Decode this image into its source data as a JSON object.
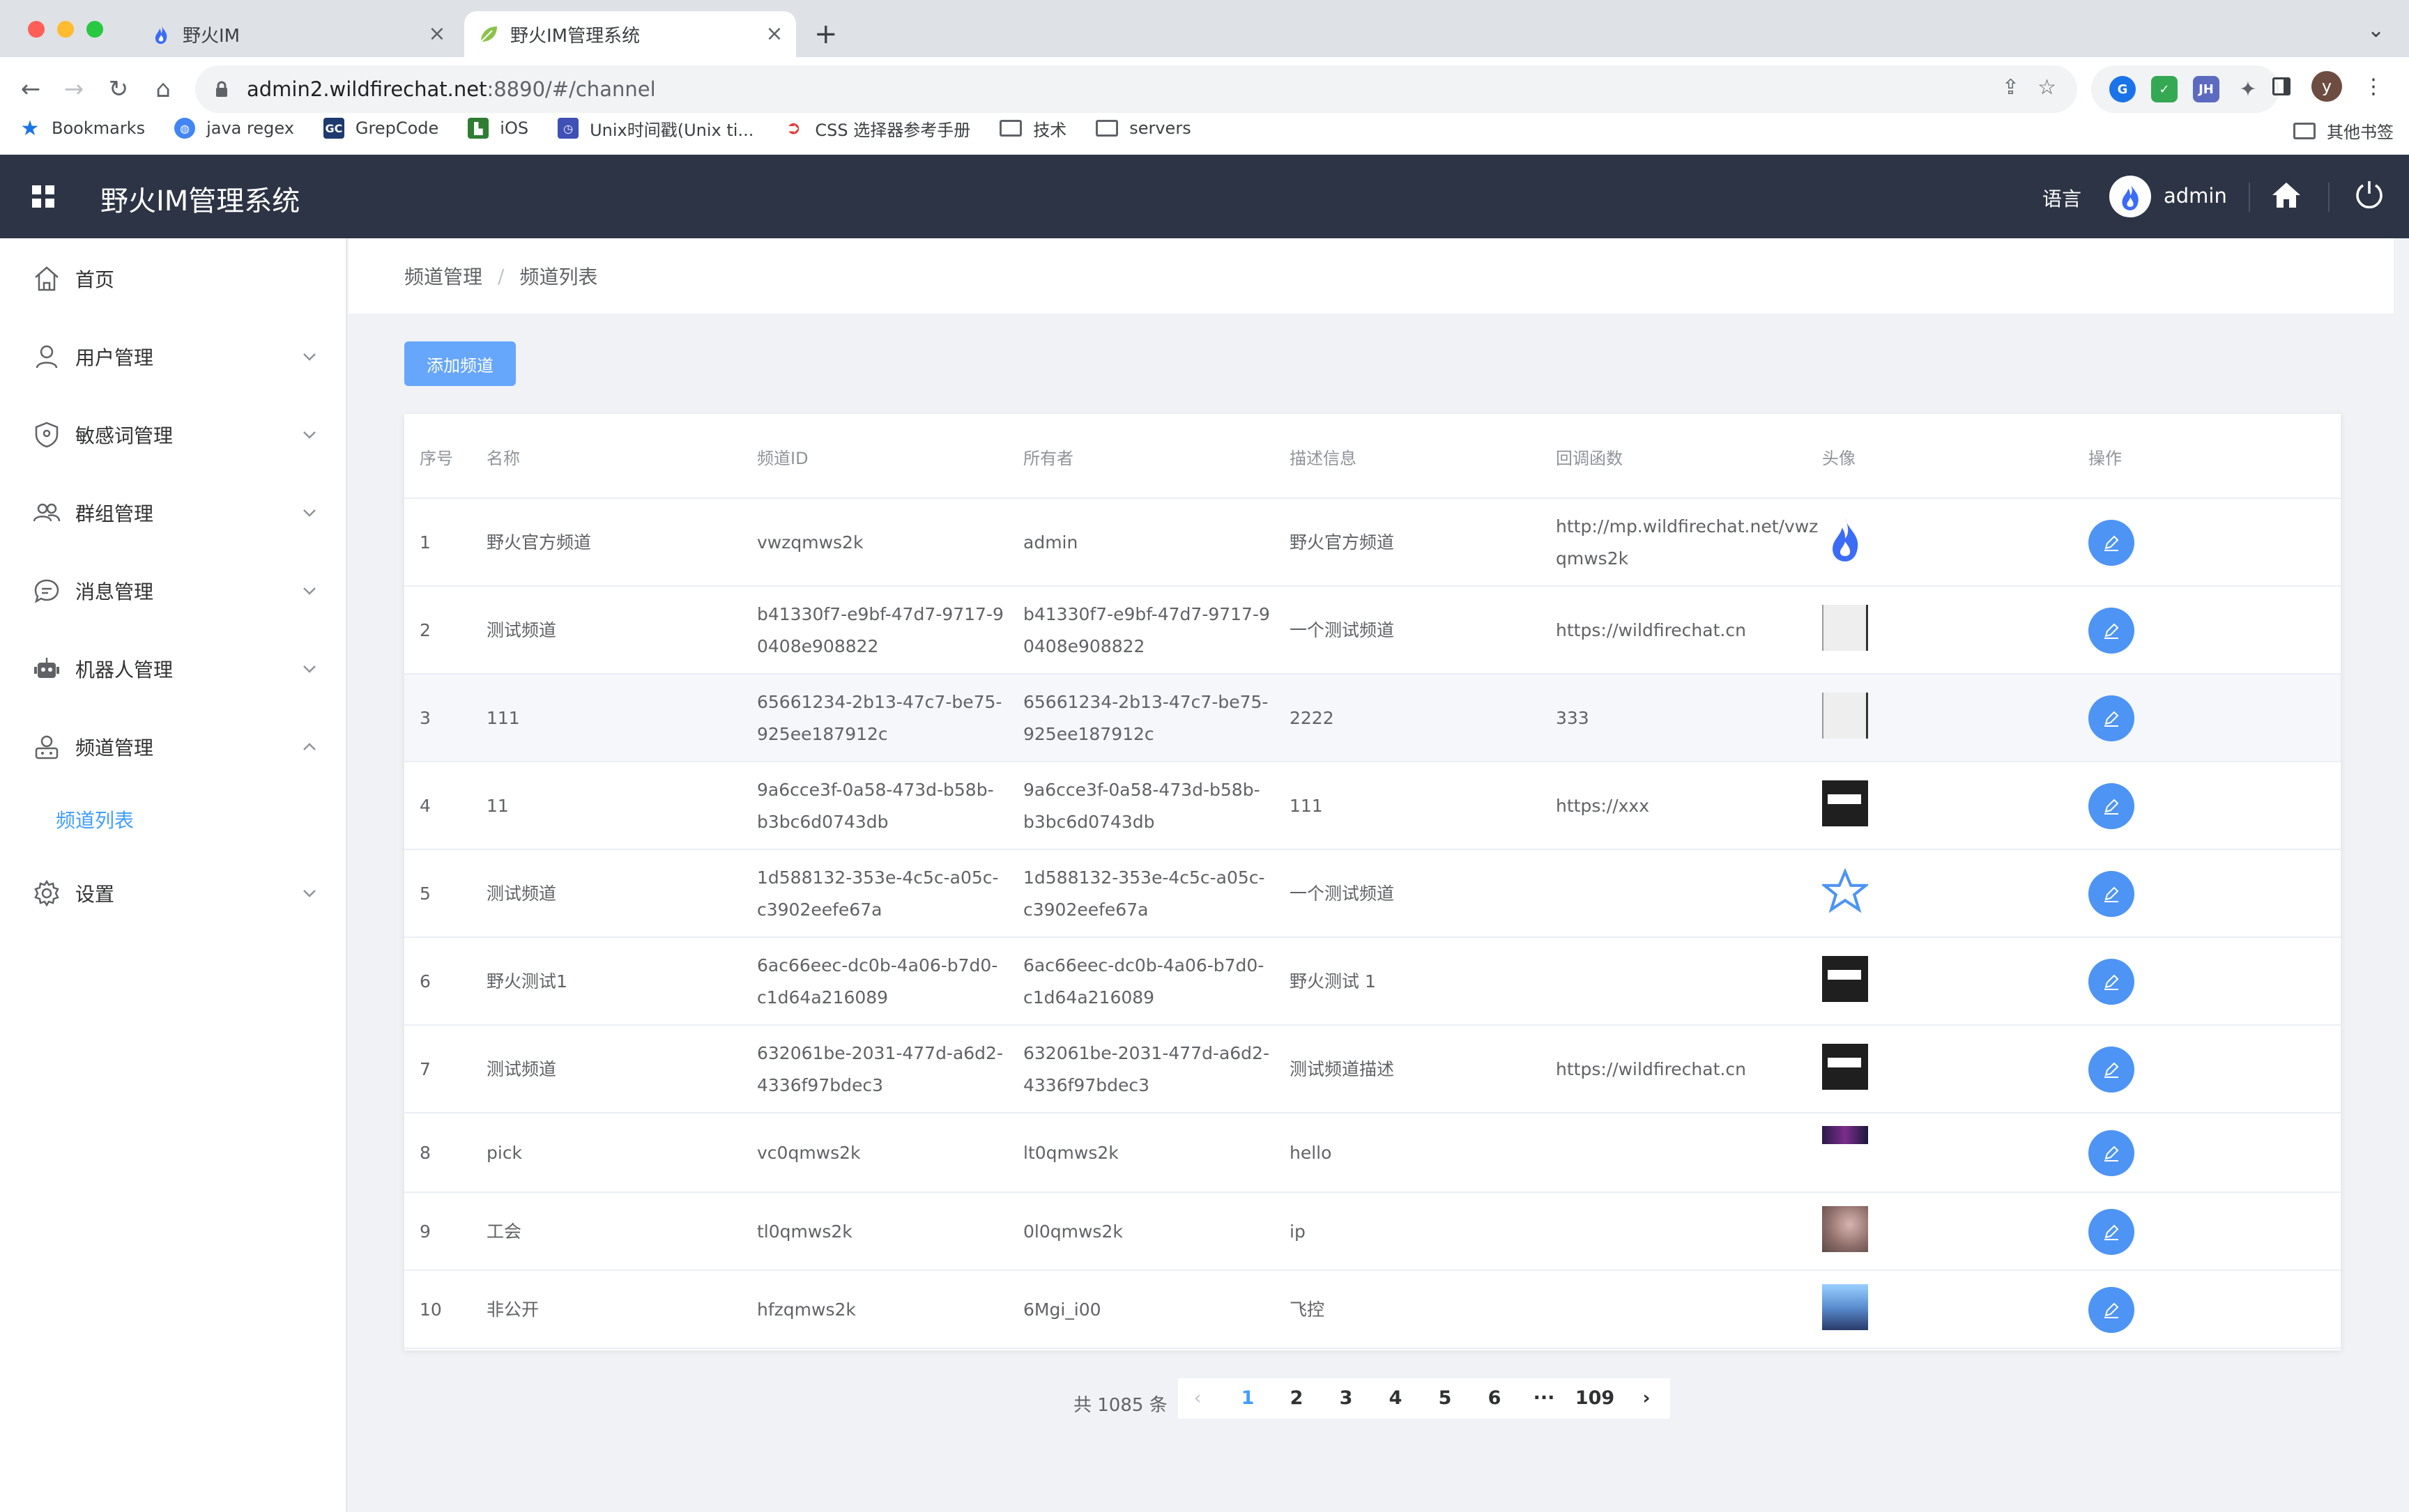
{
  "browser": {
    "tabs": [
      {
        "title": "野火IM",
        "active": false
      },
      {
        "title": "野火IM管理系统",
        "active": true
      }
    ],
    "url_host": "admin2.wildfirechat.net",
    "url_rest": ":8890/#/channel",
    "bookmarks": [
      {
        "label": "Bookmarks",
        "icon": "star-icon"
      },
      {
        "label": "java regex",
        "icon": "globe-icon"
      },
      {
        "label": "GrepCode",
        "icon": "gc-icon"
      },
      {
        "label": "iOS",
        "icon": "ios-icon"
      },
      {
        "label": "Unix时间戳(Unix ti...",
        "icon": "clock-icon"
      },
      {
        "label": "CSS 选择器参考手册",
        "icon": "css-icon"
      },
      {
        "label": "技术",
        "icon": "folder-icon"
      },
      {
        "label": "servers",
        "icon": "folder-icon"
      }
    ],
    "other_bookmarks": "其他书签",
    "ext_jh": "JH",
    "profile_initial": "y"
  },
  "header": {
    "title": "野火IM管理系统",
    "language": "语言",
    "user": "admin"
  },
  "sidebar": {
    "items": [
      {
        "label": "首页",
        "icon": "home-icon"
      },
      {
        "label": "用户管理",
        "icon": "user-icon"
      },
      {
        "label": "敏感词管理",
        "icon": "shield-icon"
      },
      {
        "label": "群组管理",
        "icon": "group-icon"
      },
      {
        "label": "消息管理",
        "icon": "message-icon"
      },
      {
        "label": "机器人管理",
        "icon": "robot-icon"
      },
      {
        "label": "频道管理",
        "icon": "channel-icon"
      },
      {
        "label": "设置",
        "icon": "gear-icon"
      }
    ],
    "sub_item": "频道列表"
  },
  "breadcrumb": {
    "parent": "频道管理",
    "current": "频道列表"
  },
  "add_button": "添加频道",
  "table": {
    "headers": [
      "序号",
      "名称",
      "频道ID",
      "所有者",
      "描述信息",
      "回调函数",
      "头像",
      "操作"
    ],
    "rows": [
      {
        "index": "1",
        "name": "野火官方频道",
        "id1": "vwzqmws2k",
        "id2": "",
        "owner1": "admin",
        "owner2": "",
        "desc": "野火官方频道",
        "cb1": "http://mp.wildfirechat.net/vwz",
        "cb2": "qmws2k",
        "avatar": "flame"
      },
      {
        "index": "2",
        "name": "测试频道",
        "id1": "b41330f7-e9bf-47d7-9717-9",
        "id2": "0408e908822",
        "owner1": "b41330f7-e9bf-47d7-9717-9",
        "owner2": "0408e908822",
        "desc": "一个测试频道",
        "cb1": "https://wildfirechat.cn",
        "cb2": "",
        "avatar": "blank"
      },
      {
        "index": "3",
        "name": "111",
        "id1": "65661234-2b13-47c7-be75-",
        "id2": "925ee187912c",
        "owner1": "65661234-2b13-47c7-be75-",
        "owner2": "925ee187912c",
        "desc": "2222",
        "cb1": "333",
        "cb2": "",
        "avatar": "blank"
      },
      {
        "index": "4",
        "name": "11",
        "id1": "9a6cce3f-0a58-473d-b58b-",
        "id2": "b3bc6d0743db",
        "owner1": "9a6cce3f-0a58-473d-b58b-",
        "owner2": "b3bc6d0743db",
        "desc": "111",
        "cb1": "https://xxx",
        "cb2": "",
        "avatar": "dark"
      },
      {
        "index": "5",
        "name": "测试频道",
        "id1": "1d588132-353e-4c5c-a05c-",
        "id2": "c3902eefe67a",
        "owner1": "1d588132-353e-4c5c-a05c-",
        "owner2": "c3902eefe67a",
        "desc": "一个测试频道",
        "cb1": "",
        "cb2": "",
        "avatar": "star"
      },
      {
        "index": "6",
        "name": "野火测试1",
        "id1": "6ac66eec-dc0b-4a06-b7d0-",
        "id2": "c1d64a216089",
        "owner1": "6ac66eec-dc0b-4a06-b7d0-",
        "owner2": "c1d64a216089",
        "desc": "野火测试 1",
        "cb1": "",
        "cb2": "",
        "avatar": "dark"
      },
      {
        "index": "7",
        "name": "测试频道",
        "id1": "632061be-2031-477d-a6d2-",
        "id2": "4336f97bdec3",
        "owner1": "632061be-2031-477d-a6d2-",
        "owner2": "4336f97bdec3",
        "desc": "测试频道描述",
        "cb1": "https://wildfirechat.cn",
        "cb2": "",
        "avatar": "dark"
      },
      {
        "index": "8",
        "name": "pick",
        "id1": "vc0qmws2k",
        "id2": "",
        "owner1": "lt0qmws2k",
        "owner2": "",
        "desc": "hello",
        "cb1": "",
        "cb2": "",
        "avatar": "banner"
      },
      {
        "index": "9",
        "name": "工会",
        "id1": "tl0qmws2k",
        "id2": "",
        "owner1": "0l0qmws2k",
        "owner2": "",
        "desc": "ip",
        "cb1": "",
        "cb2": "",
        "avatar": "photo"
      },
      {
        "index": "10",
        "name": "非公开",
        "id1": "hfzqmws2k",
        "id2": "",
        "owner1": "6Mgi_i00",
        "owner2": "",
        "desc": "飞控",
        "cb1": "",
        "cb2": "",
        "avatar": "anime"
      }
    ]
  },
  "pagination": {
    "total_text": "共 1085 条",
    "pages": [
      "1",
      "2",
      "3",
      "4",
      "5",
      "6"
    ],
    "ellipsis": "···",
    "last": "109",
    "current": "1"
  },
  "colors": {
    "header_bg": "#2d3445",
    "accent": "#409eff",
    "button": "#66a6fb",
    "op_button": "#4d94f5"
  }
}
